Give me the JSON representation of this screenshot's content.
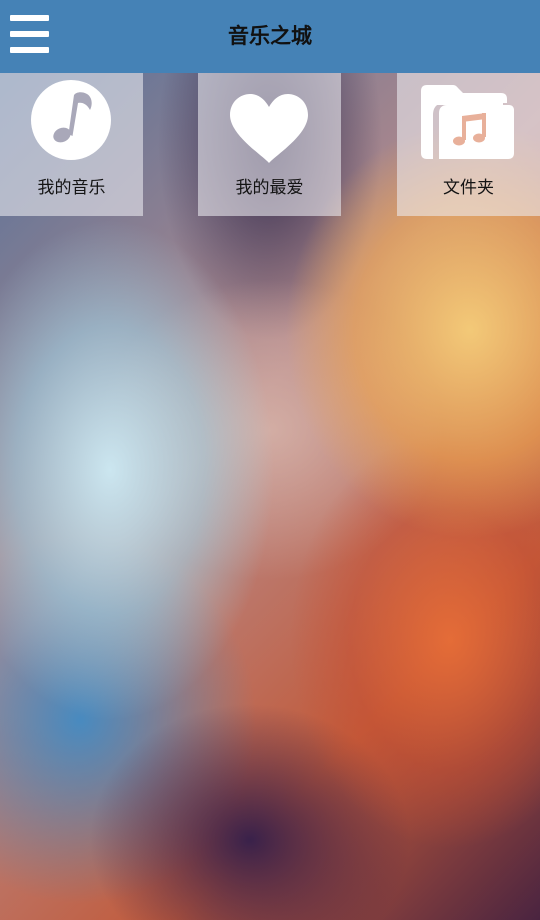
{
  "app": {
    "title": "音乐之城"
  },
  "colors": {
    "topbar": "#4582b6",
    "tile_icon": "#ffffff",
    "text": "#111111"
  },
  "header": {
    "menu_icon": "hamburger-menu-icon"
  },
  "tiles": [
    {
      "label": "我的音乐",
      "icon": "music-note-icon"
    },
    {
      "label": "我的最爱",
      "icon": "heart-icon"
    },
    {
      "label": "文件夹",
      "icon": "music-folder-icon"
    }
  ]
}
